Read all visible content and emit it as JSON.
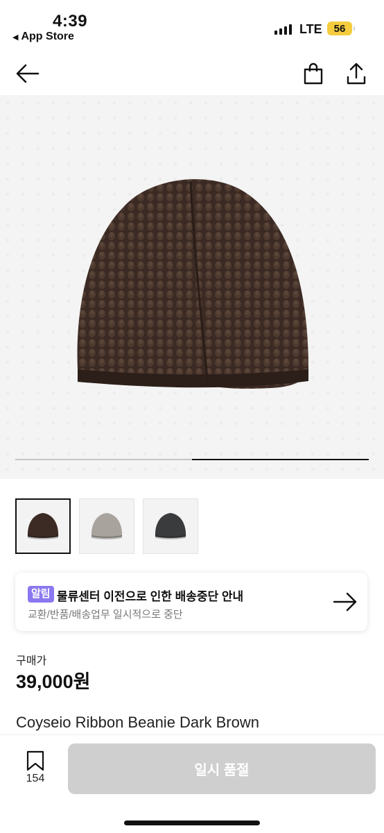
{
  "status_bar": {
    "time": "4:39",
    "back_app": "App Store",
    "network": "LTE",
    "battery": "56",
    "battery_color": "#f5cc3e"
  },
  "nav": {
    "back_icon": "arrow-left-icon",
    "bag_icon": "shopping-bag-icon",
    "share_icon": "share-icon"
  },
  "gallery": {
    "image_count": 2,
    "current_index": 2,
    "thumbnails": [
      {
        "colorway": "dark-brown",
        "color": "#3b2b24",
        "selected": true
      },
      {
        "colorway": "grey",
        "color": "#a8a39c",
        "selected": false
      },
      {
        "colorway": "charcoal",
        "color": "#3a3b3d",
        "selected": false
      }
    ]
  },
  "notice": {
    "badge": "알림",
    "title": "물류센터 이전으로 인한 배송중단 안내",
    "subtitle": "교환/반품/배송업무 일시적으로 중단",
    "badge_color": "#8a78f0"
  },
  "product": {
    "price_label": "구매가",
    "price": "39,000원",
    "name": "Coyseio Ribbon Beanie Dark Brown"
  },
  "bottom_bar": {
    "save_count": "154",
    "buy_label": "일시 품절"
  }
}
